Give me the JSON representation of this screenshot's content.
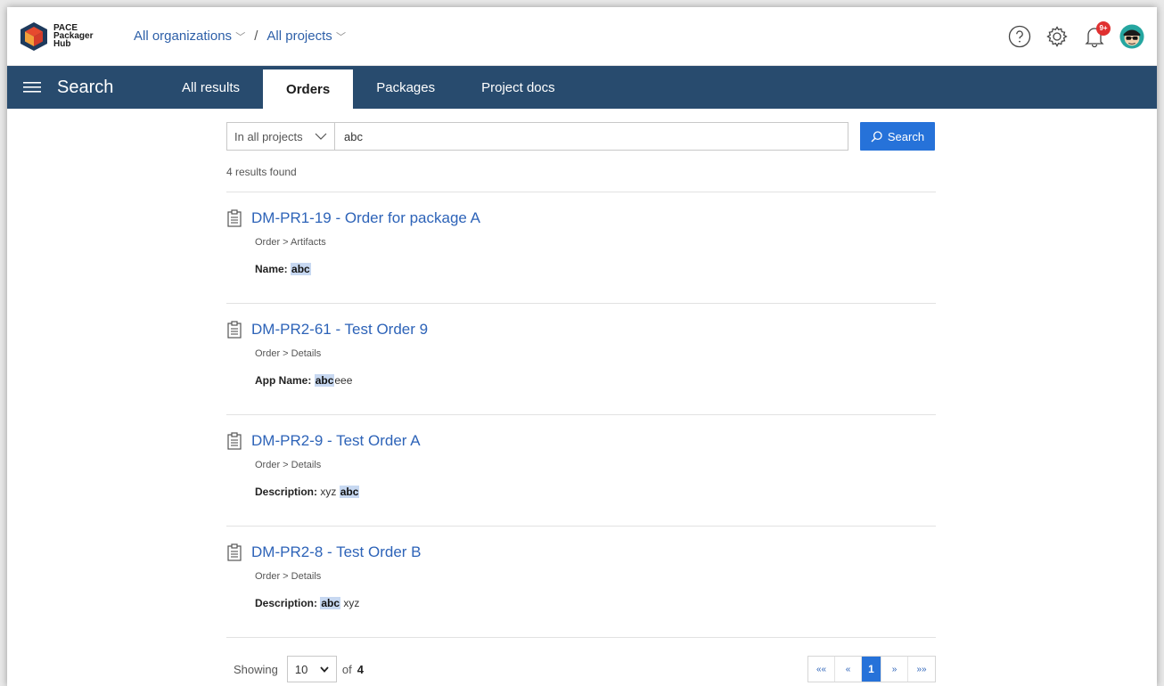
{
  "brand": {
    "line1": "PACE",
    "line2": "Packager",
    "line3": "Hub"
  },
  "breadcrumb": {
    "org": "All organizations",
    "sep": "/",
    "project": "All projects"
  },
  "notifications": {
    "badge": "9+"
  },
  "navbar": {
    "title": "Search",
    "tabs": [
      {
        "label": "All results",
        "active": false
      },
      {
        "label": "Orders",
        "active": true
      },
      {
        "label": "Packages",
        "active": false
      },
      {
        "label": "Project docs",
        "active": false
      }
    ]
  },
  "search": {
    "scope": "In all projects",
    "query": "abc",
    "button_label": "Search",
    "results_count": "4 results found"
  },
  "results": [
    {
      "title": "DM-PR1-19 - Order for package A",
      "path": "Order > Artifacts",
      "field_label": "Name:",
      "pre": "",
      "match": "abc",
      "post": ""
    },
    {
      "title": "DM-PR2-61 - Test Order 9",
      "path": "Order > Details",
      "field_label": "App Name:",
      "pre": "",
      "match": "abc",
      "post": "eee"
    },
    {
      "title": "DM-PR2-9 - Test Order A",
      "path": "Order > Details",
      "field_label": "Description:",
      "pre": "xyz ",
      "match": "abc",
      "post": ""
    },
    {
      "title": "DM-PR2-8 - Test Order B",
      "path": "Order > Details",
      "field_label": "Description:",
      "pre": "",
      "match": "abc",
      "post": " xyz"
    }
  ],
  "footer": {
    "showing_label": "Showing",
    "page_size": "10",
    "of_label": "of",
    "total": "4",
    "pager": {
      "first": "««",
      "prev": "«",
      "current": "1",
      "next": "»",
      "last": "»»"
    }
  },
  "colors": {
    "navbar": "#284b6e",
    "accent": "#2672d9",
    "link": "#2d63b8",
    "highlight": "#c7d8f1",
    "badge": "#e03030"
  }
}
